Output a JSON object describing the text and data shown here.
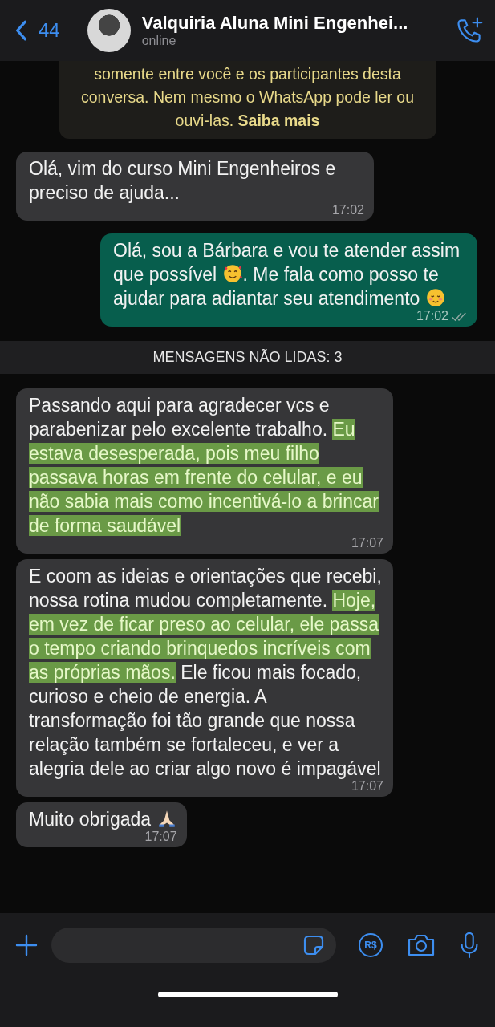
{
  "header": {
    "back_count": "44",
    "contact_name": "Valquiria Aluna Mini Engenhei...",
    "status": "online"
  },
  "encryption_notice": {
    "text": "somente entre você e os participantes desta conversa. Nem mesmo o WhatsApp pode ler ou ouvi-las.",
    "link": "Saiba mais"
  },
  "messages": [
    {
      "kind": "incoming",
      "time": "17:02",
      "parts": [
        {
          "kind": "text",
          "text": "Olá, vim do curso Mini Engenheiros e preciso de ajuda...",
          "highlighted": false
        }
      ]
    },
    {
      "kind": "outgoing",
      "time": "17:02",
      "read": false,
      "parts": [
        {
          "kind": "text",
          "text": "Olá, sou a Bárbara e vou te atender assim que possível ",
          "highlighted": false
        },
        {
          "kind": "hearts"
        },
        {
          "kind": "text",
          "text": ". Me fala como posso te ajudar para adiantar seu atendimento ",
          "highlighted": false
        },
        {
          "kind": "smile"
        }
      ]
    },
    {
      "kind": "divider",
      "text": "MENSAGENS NÃO LIDAS: 3"
    },
    {
      "kind": "incoming",
      "time": "17:07",
      "parts": [
        {
          "kind": "text",
          "text": "Passando aqui para agradecer vcs e parabenizar pelo excelente trabalho. ",
          "highlighted": false
        },
        {
          "kind": "text",
          "text": "Eu estava desesperada, pois meu filho passava horas em frente do celular, e eu não sabia mais como incentivá-lo a brincar de forma saudável ",
          "highlighted": true
        }
      ]
    },
    {
      "kind": "incoming",
      "time": "17:07",
      "parts": [
        {
          "kind": "text",
          "text": "E coom as ideias e orientações que recebi, nossa rotina mudou completamente. ",
          "highlighted": false
        },
        {
          "kind": "text",
          "text": "Hoje, em vez de ficar preso ao celular, ele passa o tempo criando brinquedos incríveis com as próprias mãos.",
          "highlighted": true
        },
        {
          "kind": "text",
          "text": " Ele ficou mais focado, curioso e cheio de energia. A transformação foi tão grande que nossa relação também se fortaleceu, e ver a alegria dele ao criar algo novo é impagável",
          "highlighted": false
        }
      ]
    },
    {
      "kind": "incoming",
      "time": "17:07",
      "parts": [
        {
          "kind": "text",
          "text": "Muito obrigada ",
          "highlighted": false
        },
        {
          "kind": "pray"
        }
      ]
    }
  ],
  "composer": {
    "payment_label": "R$"
  }
}
